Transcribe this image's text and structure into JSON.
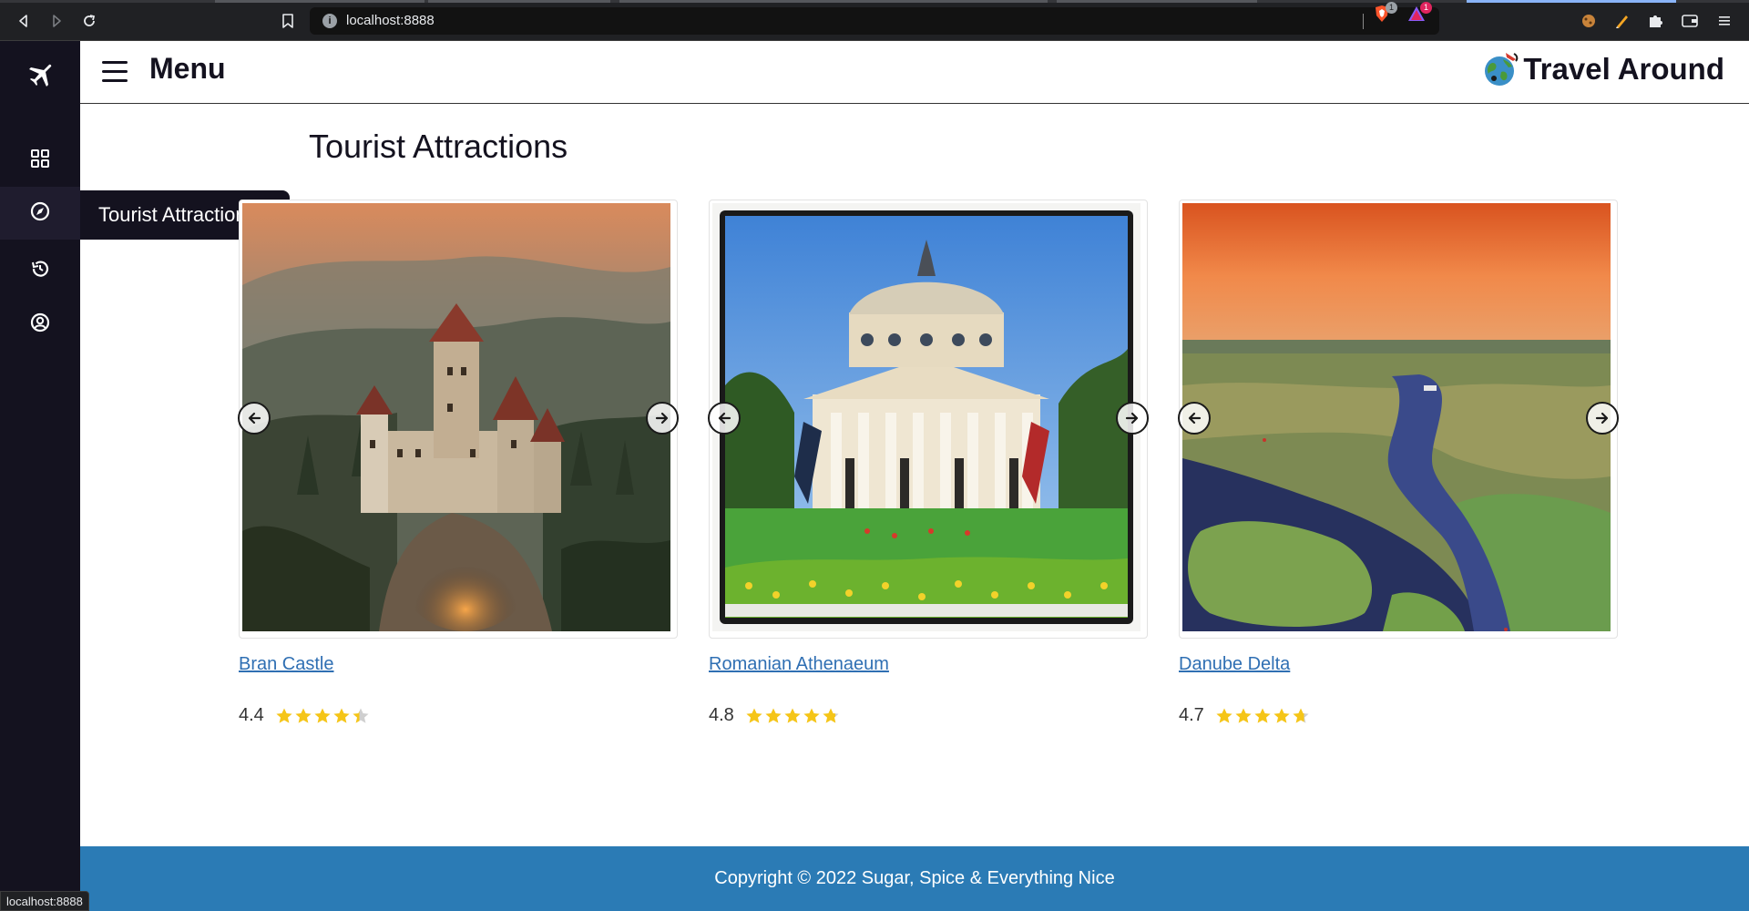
{
  "browser": {
    "url": "localhost:8888",
    "brave_shield_count": "1",
    "brave_rewards_count": "1",
    "status_url": "localhost:8888"
  },
  "sidebar": {
    "items": [
      {
        "name": "dashboard",
        "icon": "grid-icon"
      },
      {
        "name": "tourist-attractions",
        "icon": "compass-icon",
        "active": true
      },
      {
        "name": "history",
        "icon": "history-icon"
      },
      {
        "name": "account",
        "icon": "user-circle-icon"
      }
    ],
    "tooltip": "Tourist Attractions"
  },
  "header": {
    "menu_label": "Menu",
    "brand": "Travel Around"
  },
  "main": {
    "title": "Tourist Attractions",
    "attractions": [
      {
        "name": "Bran Castle",
        "rating": "4.4",
        "rating_value": 4.4
      },
      {
        "name": "Romanian Athenaeum",
        "rating": "4.8",
        "rating_value": 4.8
      },
      {
        "name": "Danube Delta",
        "rating": "4.7",
        "rating_value": 4.7
      }
    ]
  },
  "footer": {
    "copyright": "Copyright © 2022 Sugar, Spice & Everything Nice"
  },
  "colors": {
    "sidebar_bg": "#14121f",
    "footer_bg": "#2b7bb5",
    "link": "#2f6fb3",
    "star": "#f5c518"
  }
}
